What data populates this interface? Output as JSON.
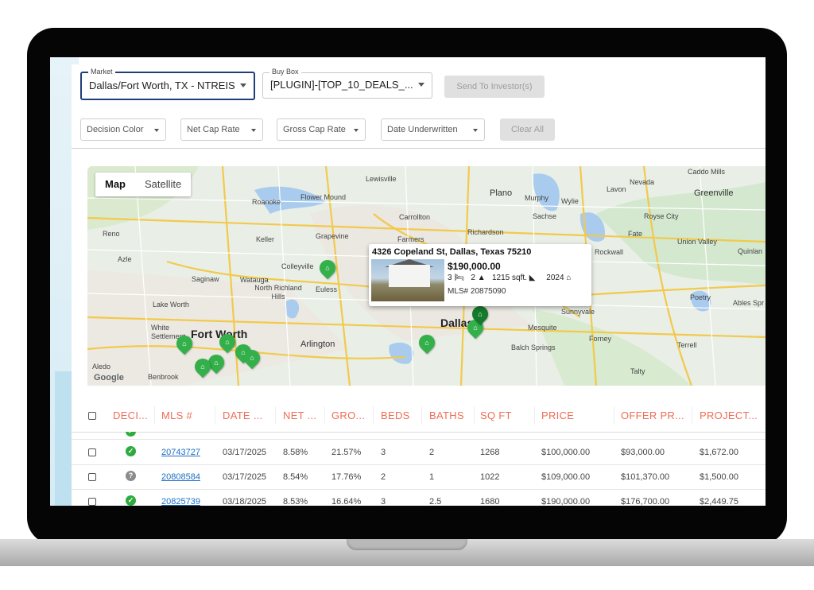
{
  "toolbar": {
    "market_label": "Market",
    "market_value": "Dallas/Fort Worth, TX - NTREIS",
    "buybox_label": "Buy Box",
    "buybox_value": "[PLUGIN]-[TOP_10_DEALS_...",
    "send_button": "Send To Investor(s)"
  },
  "filters": {
    "items": [
      "Decision Color",
      "Net Cap Rate",
      "Gross Cap Rate",
      "Date Underwritten"
    ],
    "clear_all": "Clear All"
  },
  "map": {
    "toggle": [
      "Map",
      "Satellite"
    ],
    "google": "Google",
    "labels": {
      "lewisville": "Lewisville",
      "flower_mound": "Flower Mound",
      "roanoke": "Roanoke",
      "carrollton": "Carrollton",
      "plano": "Plano",
      "murphy": "Murphy",
      "wylie": "Wylie",
      "caddo_mills": "Caddo Mills",
      "nevada": "Nevada",
      "lavon": "Lavon",
      "greenville": "Greenville",
      "reno": "Reno",
      "keller": "Keller",
      "grapevine": "Grapevine",
      "farmers": "Farmers",
      "richardson": "Richardson",
      "sachse": "Sachse",
      "royse_city": "Royse City",
      "fate": "Fate",
      "union_valley": "Union Valley",
      "quinlan": "Quinlan",
      "azle": "Azle",
      "colleyville": "Colleyville",
      "rockwall": "Rockwall",
      "saginaw": "Saginaw",
      "watauga": "Watauga",
      "north_richland": "North Richland Hills",
      "euless": "Euless",
      "lake_worth": "Lake Worth",
      "dallas": "Dallas",
      "sunnyvale": "Sunnyvale",
      "poetry": "Poetry",
      "ables_springs": "Ables Spr",
      "white_settlement": "White Settlement",
      "fort_worth": "Fort Worth",
      "arlington": "Arlington",
      "mesquite": "Mesquite",
      "forney": "Forney",
      "balch_springs": "Balch Springs",
      "terrell": "Terrell",
      "aledo": "Aledo",
      "benbrook": "Benbrook",
      "talty": "Talty"
    },
    "popup": {
      "address": "4326 Copeland St, Dallas, Texas 75210",
      "price": "$190,000.00",
      "beds": "3",
      "baths": "2",
      "sqft": "1215 sqft.",
      "year": "2024",
      "mls": "MLS# 20875090"
    }
  },
  "table": {
    "headers": [
      "DECI...",
      "MLS #",
      "DATE ...",
      "NET ...",
      "GRO...",
      "BEDS",
      "BATHS",
      "SQ FT",
      "PRICE",
      "OFFER PR...",
      "PROJECT..."
    ],
    "rows": [
      {
        "status": "green",
        "mls": "20743727",
        "date": "03/17/2025",
        "net": "8.58%",
        "gross": "21.57%",
        "beds": "3",
        "baths": "2",
        "sqft": "1268",
        "price": "$100,000.00",
        "offer": "$93,000.00",
        "project": "$1,672.00"
      },
      {
        "status": "grey",
        "mls": "20808584",
        "date": "03/17/2025",
        "net": "8.54%",
        "gross": "17.76%",
        "beds": "2",
        "baths": "1",
        "sqft": "1022",
        "price": "$109,000.00",
        "offer": "$101,370.00",
        "project": "$1,500.00"
      },
      {
        "status": "green",
        "mls": "20825739",
        "date": "03/18/2025",
        "net": "8.53%",
        "gross": "16.64%",
        "beds": "3",
        "baths": "2.5",
        "sqft": "1680",
        "price": "$190,000.00",
        "offer": "$176,700.00",
        "project": "$2,449.75"
      }
    ]
  }
}
